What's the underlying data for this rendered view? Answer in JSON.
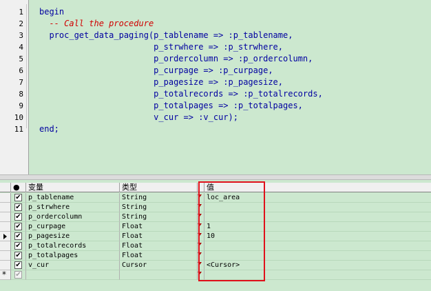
{
  "editor": {
    "line_numbers": [
      "1",
      "2",
      "3",
      "4",
      "5",
      "6",
      "7",
      "8",
      "9",
      "10",
      "11"
    ],
    "lines": [
      {
        "text": "begin",
        "kind": "code"
      },
      {
        "text": "  -- Call the procedure",
        "kind": "comment"
      },
      {
        "text": "  proc_get_data_paging(p_tablename => :p_tablename,",
        "kind": "code"
      },
      {
        "text": "                       p_strwhere => :p_strwhere,",
        "kind": "code"
      },
      {
        "text": "                       p_ordercolumn => :p_ordercolumn,",
        "kind": "code"
      },
      {
        "text": "                       p_curpage => :p_curpage,",
        "kind": "code"
      },
      {
        "text": "                       p_pagesize => :p_pagesize,",
        "kind": "code"
      },
      {
        "text": "                       p_totalrecords => :p_totalrecords,",
        "kind": "code"
      },
      {
        "text": "                       p_totalpages => :p_totalpages,",
        "kind": "code"
      },
      {
        "text": "                       v_cur => :v_cur);",
        "kind": "code"
      },
      {
        "text": "end;",
        "kind": "code"
      }
    ]
  },
  "grid": {
    "headers": {
      "enabled": "●",
      "variable": "变量",
      "type": "类型",
      "value": "值"
    },
    "rows": [
      {
        "variable": "p_tablename",
        "type": "String",
        "value": "loc_area",
        "checked": true,
        "current": false
      },
      {
        "variable": "p_strwhere",
        "type": "String",
        "value": "",
        "checked": true,
        "current": false
      },
      {
        "variable": "p_ordercolumn",
        "type": "String",
        "value": "",
        "checked": true,
        "current": false
      },
      {
        "variable": "p_curpage",
        "type": "Float",
        "value": "1",
        "checked": true,
        "current": false
      },
      {
        "variable": "p_pagesize",
        "type": "Float",
        "value": "10",
        "checked": true,
        "current": true
      },
      {
        "variable": "p_totalrecords",
        "type": "Float",
        "value": "",
        "checked": true,
        "current": false
      },
      {
        "variable": "p_totalpages",
        "type": "Float",
        "value": "",
        "checked": true,
        "current": false
      },
      {
        "variable": "v_cur",
        "type": "Cursor",
        "value": "<Cursor>",
        "checked": true,
        "current": false
      }
    ],
    "new_row_marker": "*"
  },
  "colors": {
    "editor_bg": "#cce8cf",
    "keyword": "#0000a0",
    "comment": "#d00000",
    "highlight_box": "#e0101a"
  }
}
